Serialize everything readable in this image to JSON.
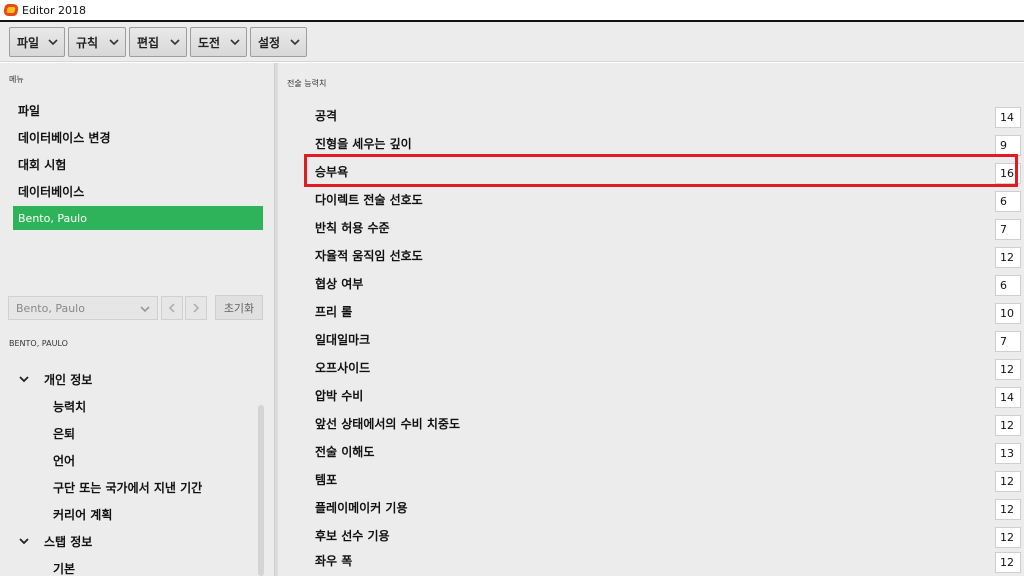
{
  "window": {
    "title": "Editor 2018"
  },
  "toolbar": {
    "menus": [
      {
        "label": "파일"
      },
      {
        "label": "규칙"
      },
      {
        "label": "편집"
      },
      {
        "label": "도전"
      },
      {
        "label": "설정"
      }
    ]
  },
  "sidebar": {
    "menu_label": "메뉴",
    "items": [
      {
        "label": "파일"
      },
      {
        "label": "데이터베이스 변경"
      },
      {
        "label": "대회 시험"
      },
      {
        "label": "데이터베이스"
      },
      {
        "label": "Bento, Paulo"
      }
    ],
    "person_select": {
      "value": "Bento, Paulo"
    },
    "reset_label": "초기화",
    "section_label": "BENTO, PAULO",
    "tree": {
      "personal_info": {
        "label": "개인 정보",
        "children": [
          {
            "label": "능력치"
          },
          {
            "label": "은퇴"
          },
          {
            "label": "언어"
          },
          {
            "label": "구단 또는 국가에서 지낸 기간"
          },
          {
            "label": "커리어 계획"
          }
        ]
      },
      "staff_info": {
        "label": "스탭 정보",
        "children": [
          {
            "label": "기본"
          }
        ]
      }
    }
  },
  "main": {
    "section_label": "전술 능력치",
    "attributes": [
      {
        "label": "공격",
        "value": "14"
      },
      {
        "label": "진형을 세우는 깊이",
        "value": "9"
      },
      {
        "label": "승부욕",
        "value": "16"
      },
      {
        "label": "다이렉트 전술 선호도",
        "value": "6"
      },
      {
        "label": "반칙 허용 수준",
        "value": "7"
      },
      {
        "label": "자율적 움직임 선호도",
        "value": "12"
      },
      {
        "label": "협상 여부",
        "value": "6"
      },
      {
        "label": "프리 롤",
        "value": "10"
      },
      {
        "label": "일대일마크",
        "value": "7"
      },
      {
        "label": "오프사이드",
        "value": "12"
      },
      {
        "label": "압박 수비",
        "value": "14"
      },
      {
        "label": "앞선 상태에서의 수비 치중도",
        "value": "12"
      },
      {
        "label": "전술 이해도",
        "value": "13"
      },
      {
        "label": "템포",
        "value": "12"
      },
      {
        "label": "플레이메이커 기용",
        "value": "12"
      },
      {
        "label": "후보 선수 기용",
        "value": "12"
      },
      {
        "label": "좌우 폭",
        "value": "12"
      }
    ]
  },
  "colors": {
    "accent": "#2fb35a",
    "highlight": "#e01b24"
  }
}
